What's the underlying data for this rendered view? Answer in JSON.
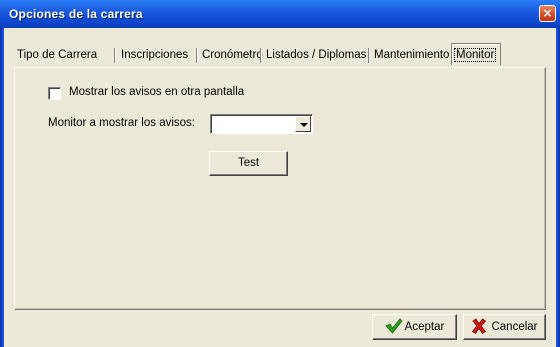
{
  "window": {
    "title": "Opciones de la carrera",
    "close_glyph": "×"
  },
  "tabs": [
    {
      "label": "Tipo de Carrera"
    },
    {
      "label": "Inscripciones"
    },
    {
      "label": "Cronómetro"
    },
    {
      "label": "Listados / Diplomas"
    },
    {
      "label": "Mantenimiento"
    },
    {
      "label": "Monitor",
      "active": true
    }
  ],
  "monitor": {
    "checkbox_label": "Mostrar los avisos en otra pantalla",
    "checkbox_checked": false,
    "select_label": "Monitor a mostrar los avisos:",
    "select_value": "",
    "test_button": "Test"
  },
  "footer": {
    "accept_label": "Aceptar",
    "cancel_label": "Cancelar"
  },
  "icons": {
    "accept": "checkmark-icon",
    "cancel": "x-mark-icon"
  },
  "colors": {
    "titlebar": "#0f4bd4",
    "close": "#d8532a",
    "dialog_bg": "#ece9d8",
    "accept_icon": "#2e9e1e",
    "cancel_icon": "#d01a10"
  }
}
